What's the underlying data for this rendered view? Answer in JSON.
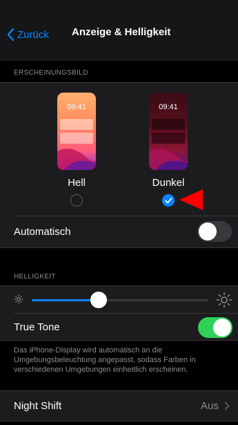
{
  "nav": {
    "back_label": "Zurück",
    "title": "Anzeige & Helligkeit"
  },
  "appearance": {
    "header": "ERSCHEINUNGSBILD",
    "light": {
      "label": "Hell",
      "time": "09:41",
      "selected": false
    },
    "dark": {
      "label": "Dunkel",
      "time": "09:41",
      "selected": true
    },
    "automatic_label": "Automatisch",
    "automatic_on": false
  },
  "brightness": {
    "header": "HELLIGKEIT",
    "level": 0.33,
    "true_tone_label": "True Tone",
    "true_tone_on": true,
    "note": "Das iPhone-Display wird automatisch an die Umgebungsbeleuchtung angepasst, sodass Farben in verschiedenen Umgebungen einheitlich erscheinen."
  },
  "night_shift": {
    "label": "Night Shift",
    "value": "Aus"
  },
  "colors": {
    "accent": "#0a84ff",
    "toggle_on": "#30d158",
    "toggle_off": "#39393d",
    "annotation_arrow": "#ff0000"
  },
  "icons": [
    "chevron-left-icon",
    "checkmark-icon",
    "sun-small-icon",
    "sun-large-icon",
    "chevron-right-icon",
    "red-arrow-icon"
  ]
}
